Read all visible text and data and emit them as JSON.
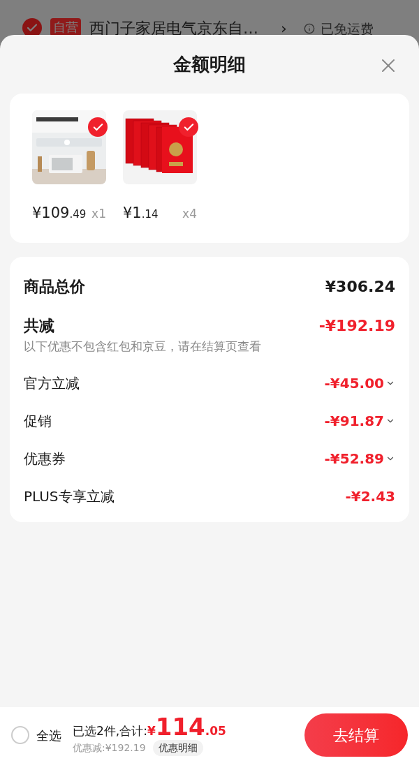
{
  "background_row": {
    "checked": true,
    "badge": "自营",
    "shop": "西门子家居电气京东自…",
    "chevron": "›",
    "shipping": "已免运费"
  },
  "sheet": {
    "title": "金额明细",
    "products": [
      {
        "kind": "appliance",
        "checked": true,
        "price_int": "¥109",
        "price_dec": ".49",
        "qty": "x1"
      },
      {
        "kind": "envelopes",
        "checked": true,
        "price_int": "¥1",
        "price_dec": ".14",
        "qty": "x4"
      }
    ],
    "total": {
      "label": "商品总价",
      "value": "¥306.24"
    },
    "discount": {
      "label": "共减",
      "value": "-¥192.19",
      "note": "以下优惠不包含红包和京豆，请在结算页查看"
    },
    "items": [
      {
        "label": "官方立减",
        "value": "-¥45.00",
        "expandable": true
      },
      {
        "label": "促销",
        "value": "-¥91.87",
        "expandable": true
      },
      {
        "label": "优惠券",
        "value": "-¥52.89",
        "expandable": true
      },
      {
        "label": "PLUS专享立减",
        "value": "-¥2.43",
        "expandable": false
      }
    ]
  },
  "footer": {
    "select_all_checked": false,
    "select_all_label": "全选",
    "selected_text": "已选2件,合计:",
    "currency": "¥",
    "amount_int": "114",
    "amount_dec": ".05",
    "discount_text": "优惠减:¥192.19",
    "detail_button": "优惠明细",
    "checkout": "去结算"
  }
}
